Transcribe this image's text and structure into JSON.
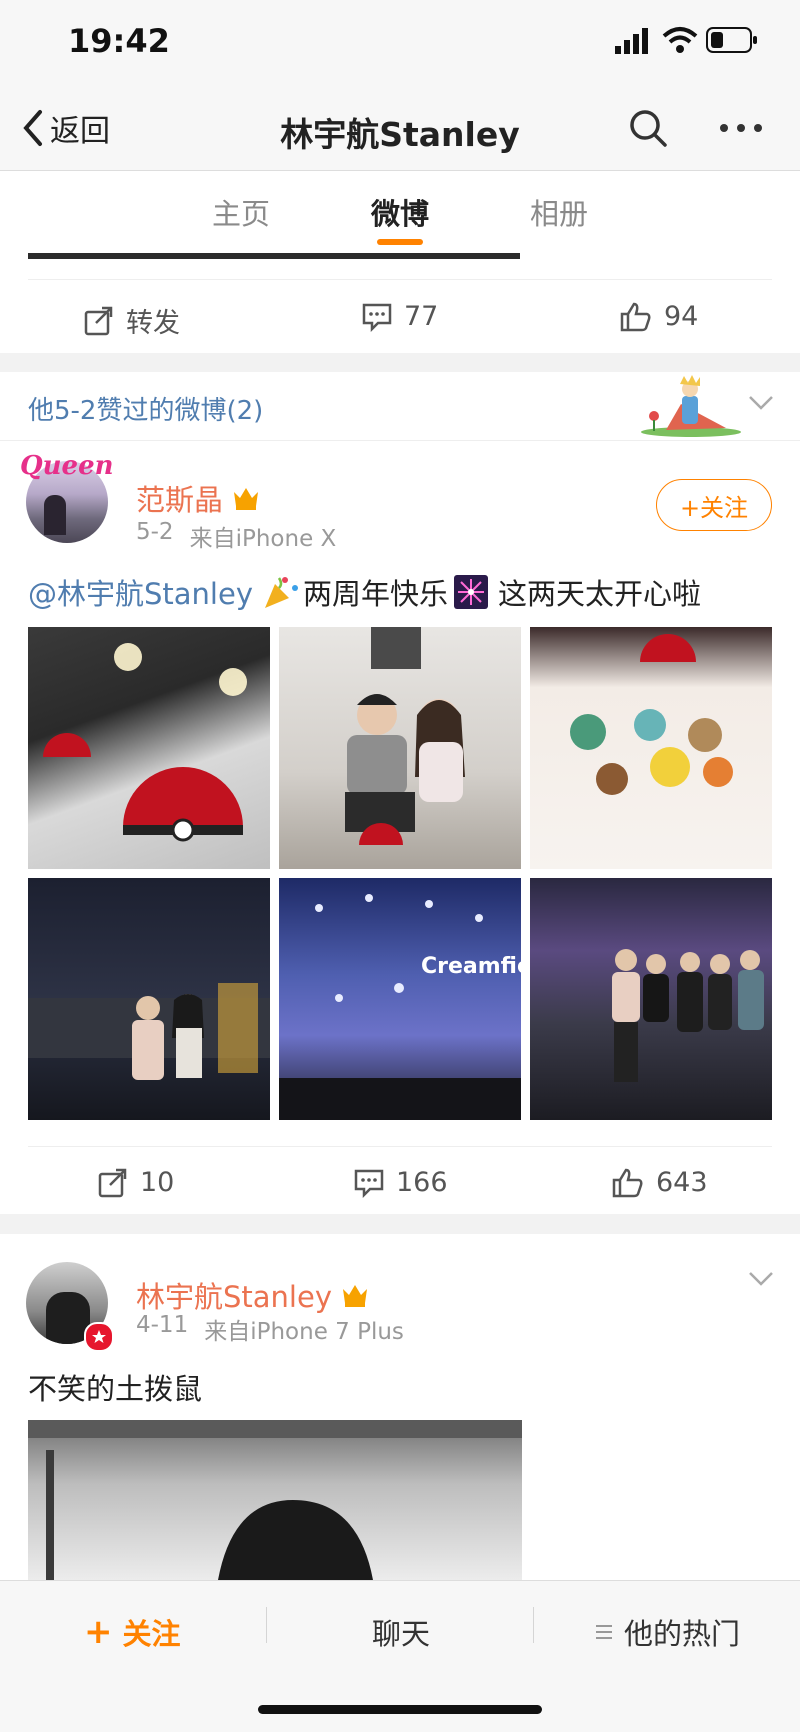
{
  "status_bar": {
    "time": "19:42"
  },
  "nav": {
    "back_label": "返回",
    "title": "林宇航Stanley"
  },
  "tabs": [
    {
      "label": "主页",
      "active": false
    },
    {
      "label": "微博",
      "active": true
    },
    {
      "label": "相册",
      "active": false
    }
  ],
  "post1_actions": {
    "repost": "转发",
    "comments": "77",
    "likes": "94"
  },
  "liked_section": {
    "title": "他5-2赞过的微博(2)"
  },
  "post2": {
    "avatar_text": "Queen",
    "author": "范斯晶",
    "date": "5-2",
    "source": "来自iPhone X",
    "follow_label": "+关注",
    "mention": "@林宇航Stanley",
    "text_part1": "两周年快乐",
    "text_part2": "这两天太开心啦",
    "image_text": "Creamfields",
    "actions": {
      "reposts": "10",
      "comments": "166",
      "likes": "643"
    }
  },
  "post3": {
    "author": "林宇航Stanley",
    "date": "4-11",
    "source": "来自iPhone 7 Plus",
    "text": "不笑的土拨鼠"
  },
  "bottom_bar": {
    "follow": "关注",
    "chat": "聊天",
    "hot": "他的热门"
  },
  "colors": {
    "accent": "#ff8200",
    "name": "#eb7350",
    "link": "#507daf"
  }
}
